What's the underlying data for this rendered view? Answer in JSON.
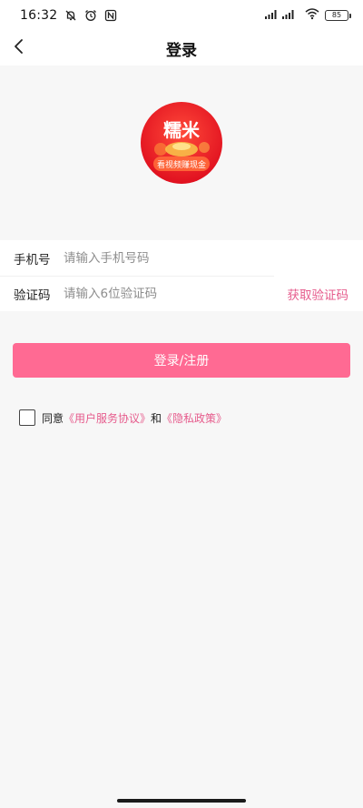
{
  "status_bar": {
    "time": "16:32",
    "battery": "85"
  },
  "nav": {
    "title": "登录"
  },
  "logo": {
    "title": "糯米",
    "slogan": "看视频赚现金"
  },
  "form": {
    "phone_label": "手机号",
    "phone_placeholder": "请输入手机号码",
    "code_label": "验证码",
    "code_placeholder": "请输入6位验证码",
    "get_code_label": "获取验证码"
  },
  "login_button": {
    "label": "登录/注册"
  },
  "agreement": {
    "prefix": "同意",
    "user_agreement": "《用户服务协议》",
    "conjunction": "和",
    "privacy_policy": "《隐私政策》"
  },
  "colors": {
    "accent": "#ff6a93",
    "link": "#e65b8c",
    "background": "#f7f7f7"
  },
  "icons": {
    "back": "chevron-left-icon",
    "mute": "bell-off-icon",
    "alarm": "alarm-icon",
    "nfc": "nfc-icon",
    "signal": "signal-icon",
    "wifi": "wifi-icon",
    "battery": "battery-icon"
  }
}
